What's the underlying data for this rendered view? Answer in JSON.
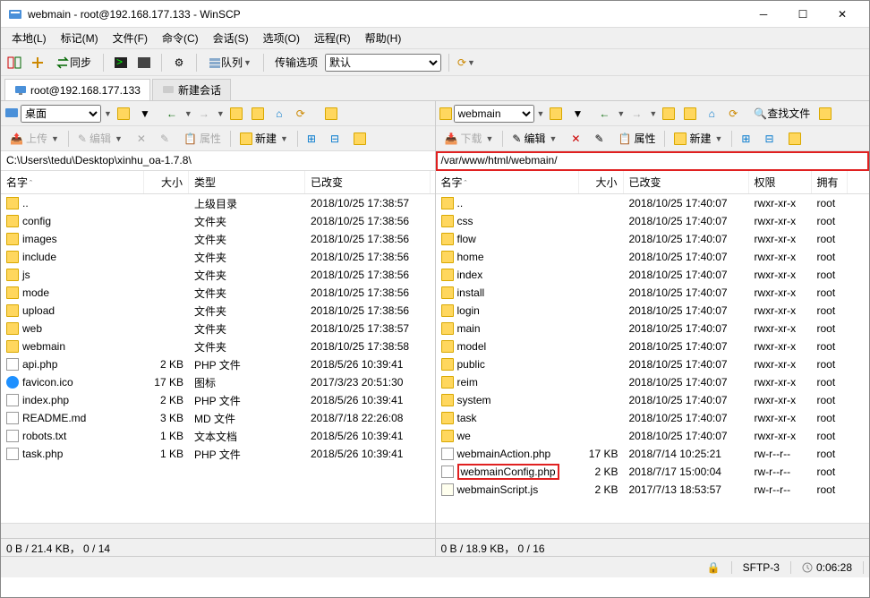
{
  "window": {
    "title": "webmain - root@192.168.177.133 - WinSCP"
  },
  "menu": [
    "本地(L)",
    "标记(M)",
    "文件(F)",
    "命令(C)",
    "会话(S)",
    "选项(O)",
    "远程(R)",
    "帮助(H)"
  ],
  "toolbar1": {
    "sync": "同步",
    "queue": "队列",
    "transfer_label": "传输选项",
    "transfer_value": "默认"
  },
  "tabs": {
    "session": "root@192.168.177.133",
    "new": "新建会话"
  },
  "left": {
    "drive": "桌面",
    "actions": {
      "upload": "上传",
      "edit": "编辑",
      "props": "属性",
      "new": "新建"
    },
    "path": "C:\\Users\\tedu\\Desktop\\xinhu_oa-1.7.8\\",
    "headers": {
      "name": "名字",
      "size": "大小",
      "type": "类型",
      "changed": "已改变"
    },
    "cols": {
      "name": 160,
      "size": 50,
      "type": 130,
      "changed": 140
    },
    "rows": [
      {
        "icon": "up",
        "name": "..",
        "size": "",
        "type": "上级目录",
        "changed": "2018/10/25  17:38:57"
      },
      {
        "icon": "folder",
        "name": "config",
        "size": "",
        "type": "文件夹",
        "changed": "2018/10/25  17:38:56"
      },
      {
        "icon": "folder",
        "name": "images",
        "size": "",
        "type": "文件夹",
        "changed": "2018/10/25  17:38:56"
      },
      {
        "icon": "folder",
        "name": "include",
        "size": "",
        "type": "文件夹",
        "changed": "2018/10/25  17:38:56"
      },
      {
        "icon": "folder",
        "name": "js",
        "size": "",
        "type": "文件夹",
        "changed": "2018/10/25  17:38:56"
      },
      {
        "icon": "folder",
        "name": "mode",
        "size": "",
        "type": "文件夹",
        "changed": "2018/10/25  17:38:56"
      },
      {
        "icon": "folder",
        "name": "upload",
        "size": "",
        "type": "文件夹",
        "changed": "2018/10/25  17:38:56"
      },
      {
        "icon": "folder",
        "name": "web",
        "size": "",
        "type": "文件夹",
        "changed": "2018/10/25  17:38:57"
      },
      {
        "icon": "folder",
        "name": "webmain",
        "size": "",
        "type": "文件夹",
        "changed": "2018/10/25  17:38:58"
      },
      {
        "icon": "file",
        "name": "api.php",
        "size": "2 KB",
        "type": "PHP 文件",
        "changed": "2018/5/26  10:39:41"
      },
      {
        "icon": "favicon",
        "name": "favicon.ico",
        "size": "17 KB",
        "type": "图标",
        "changed": "2017/3/23  20:51:30"
      },
      {
        "icon": "file",
        "name": "index.php",
        "size": "2 KB",
        "type": "PHP 文件",
        "changed": "2018/5/26  10:39:41"
      },
      {
        "icon": "file",
        "name": "README.md",
        "size": "3 KB",
        "type": "MD 文件",
        "changed": "2018/7/18  22:26:08"
      },
      {
        "icon": "file",
        "name": "robots.txt",
        "size": "1 KB",
        "type": "文本文档",
        "changed": "2018/5/26  10:39:41"
      },
      {
        "icon": "file",
        "name": "task.php",
        "size": "1 KB",
        "type": "PHP 文件",
        "changed": "2018/5/26  10:39:41"
      }
    ],
    "status": "0 B / 21.4 KB， 0 / 14"
  },
  "right": {
    "drive": "webmain",
    "actions": {
      "download": "下载",
      "edit": "编辑",
      "props": "属性",
      "new": "新建",
      "find": "查找文件"
    },
    "path": "/var/www/html/webmain/",
    "headers": {
      "name": "名字",
      "size": "大小",
      "changed": "已改变",
      "perm": "权限",
      "owner": "拥有"
    },
    "cols": {
      "name": 160,
      "size": 50,
      "changed": 140,
      "perm": 70,
      "owner": 40
    },
    "rows": [
      {
        "icon": "up",
        "name": "..",
        "size": "",
        "changed": "2018/10/25 17:40:07",
        "perm": "rwxr-xr-x",
        "owner": "root"
      },
      {
        "icon": "folder",
        "name": "css",
        "size": "",
        "changed": "2018/10/25 17:40:07",
        "perm": "rwxr-xr-x",
        "owner": "root"
      },
      {
        "icon": "folder",
        "name": "flow",
        "size": "",
        "changed": "2018/10/25 17:40:07",
        "perm": "rwxr-xr-x",
        "owner": "root"
      },
      {
        "icon": "folder",
        "name": "home",
        "size": "",
        "changed": "2018/10/25 17:40:07",
        "perm": "rwxr-xr-x",
        "owner": "root"
      },
      {
        "icon": "folder",
        "name": "index",
        "size": "",
        "changed": "2018/10/25 17:40:07",
        "perm": "rwxr-xr-x",
        "owner": "root"
      },
      {
        "icon": "folder",
        "name": "install",
        "size": "",
        "changed": "2018/10/25 17:40:07",
        "perm": "rwxr-xr-x",
        "owner": "root"
      },
      {
        "icon": "folder",
        "name": "login",
        "size": "",
        "changed": "2018/10/25 17:40:07",
        "perm": "rwxr-xr-x",
        "owner": "root"
      },
      {
        "icon": "folder",
        "name": "main",
        "size": "",
        "changed": "2018/10/25 17:40:07",
        "perm": "rwxr-xr-x",
        "owner": "root"
      },
      {
        "icon": "folder",
        "name": "model",
        "size": "",
        "changed": "2018/10/25 17:40:07",
        "perm": "rwxr-xr-x",
        "owner": "root"
      },
      {
        "icon": "folder",
        "name": "public",
        "size": "",
        "changed": "2018/10/25 17:40:07",
        "perm": "rwxr-xr-x",
        "owner": "root"
      },
      {
        "icon": "folder",
        "name": "reim",
        "size": "",
        "changed": "2018/10/25 17:40:07",
        "perm": "rwxr-xr-x",
        "owner": "root"
      },
      {
        "icon": "folder",
        "name": "system",
        "size": "",
        "changed": "2018/10/25 17:40:07",
        "perm": "rwxr-xr-x",
        "owner": "root"
      },
      {
        "icon": "folder",
        "name": "task",
        "size": "",
        "changed": "2018/10/25 17:40:07",
        "perm": "rwxr-xr-x",
        "owner": "root"
      },
      {
        "icon": "folder",
        "name": "we",
        "size": "",
        "changed": "2018/10/25 17:40:07",
        "perm": "rwxr-xr-x",
        "owner": "root"
      },
      {
        "icon": "file",
        "name": "webmainAction.php",
        "size": "17 KB",
        "changed": "2018/7/14 10:25:21",
        "perm": "rw-r--r--",
        "owner": "root"
      },
      {
        "icon": "file",
        "name": "webmainConfig.php",
        "size": "2 KB",
        "changed": "2018/7/17 15:00:04",
        "perm": "rw-r--r--",
        "owner": "root",
        "highlight": true
      },
      {
        "icon": "script",
        "name": "webmainScript.js",
        "size": "2 KB",
        "changed": "2017/7/13 18:53:57",
        "perm": "rw-r--r--",
        "owner": "root"
      }
    ],
    "status": "0 B / 18.9 KB， 0 / 16"
  },
  "bottom": {
    "lock": "🔒",
    "proto": "SFTP-3",
    "time": "0:06:28"
  }
}
